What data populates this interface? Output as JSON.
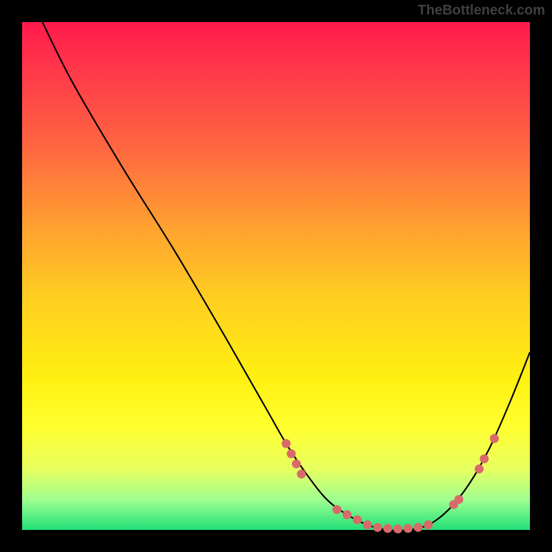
{
  "watermark": "TheBottleneck.com",
  "chart_data": {
    "type": "line",
    "title": "",
    "xlabel": "",
    "ylabel": "",
    "xlim": [
      0,
      100
    ],
    "ylim": [
      0,
      100
    ],
    "grid": false,
    "annotations": [],
    "series": [
      {
        "name": "curve",
        "color": "#000000",
        "x": [
          4,
          10,
          20,
          30,
          40,
          48,
          52,
          56,
          60,
          64,
          68,
          72,
          76,
          80,
          84,
          88,
          92,
          96,
          100
        ],
        "y": [
          100,
          88,
          71,
          55,
          38,
          24,
          17,
          11,
          6,
          3,
          1,
          0,
          0,
          1,
          4,
          9,
          16,
          25,
          35
        ]
      },
      {
        "name": "dots",
        "color": "#d86a6a",
        "type": "scatter",
        "points": [
          {
            "x": 52,
            "y": 17
          },
          {
            "x": 53,
            "y": 15
          },
          {
            "x": 54,
            "y": 13
          },
          {
            "x": 55,
            "y": 11
          },
          {
            "x": 62,
            "y": 4
          },
          {
            "x": 64,
            "y": 3
          },
          {
            "x": 66,
            "y": 2
          },
          {
            "x": 68,
            "y": 1
          },
          {
            "x": 70,
            "y": 0.5
          },
          {
            "x": 72,
            "y": 0.3
          },
          {
            "x": 74,
            "y": 0.2
          },
          {
            "x": 76,
            "y": 0.3
          },
          {
            "x": 78,
            "y": 0.5
          },
          {
            "x": 80,
            "y": 1
          },
          {
            "x": 85,
            "y": 5
          },
          {
            "x": 86,
            "y": 6
          },
          {
            "x": 90,
            "y": 12
          },
          {
            "x": 91,
            "y": 14
          },
          {
            "x": 93,
            "y": 18
          }
        ]
      }
    ]
  }
}
